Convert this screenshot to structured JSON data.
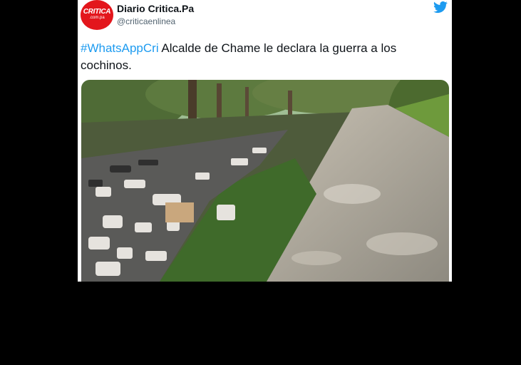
{
  "tweet": {
    "display_name": "Diario Critica.Pa",
    "handle": "@criticaenlinea",
    "hashtag": "#WhatsAppCri",
    "text": " Alcalde de Chame le declara la guerra a los cochinos.",
    "avatar_logo": "CRITICA",
    "avatar_sub": ".com.pa",
    "bird_icon": "twitter-bird-icon"
  },
  "colors": {
    "accent": "#1d9bf0",
    "brand_red": "#e3161c",
    "background": "#000000"
  }
}
